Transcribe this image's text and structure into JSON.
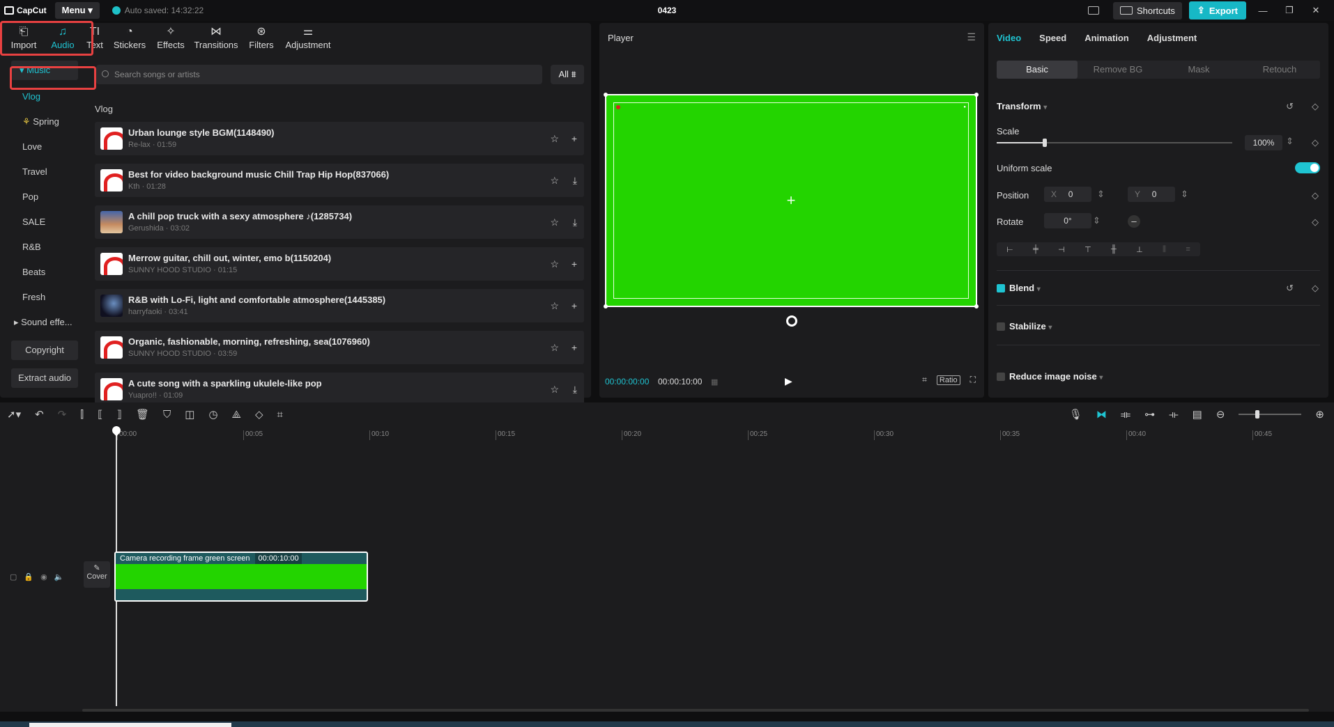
{
  "titlebar": {
    "brand": "CapCut",
    "menu": "Menu",
    "autosave": "Auto saved: 14:32:22",
    "project_title": "0423",
    "shortcuts": "Shortcuts",
    "export": "Export"
  },
  "tools": [
    {
      "label": "Import",
      "icon": "import-icon"
    },
    {
      "label": "Audio",
      "icon": "audio-icon"
    },
    {
      "label": "Text",
      "icon": "text-icon"
    },
    {
      "label": "Stickers",
      "icon": "stickers-icon"
    },
    {
      "label": "Effects",
      "icon": "effects-icon"
    },
    {
      "label": "Transitions",
      "icon": "transitions-icon"
    },
    {
      "label": "Filters",
      "icon": "filters-icon"
    },
    {
      "label": "Adjustment",
      "icon": "adjustment-icon"
    }
  ],
  "categories": {
    "music": "Music",
    "items": [
      "Vlog",
      "Spring",
      "Love",
      "Travel",
      "Pop",
      "SALE",
      "R&B",
      "Beats",
      "Fresh"
    ],
    "sound_effects": "Sound effe...",
    "copyright": "Copyright",
    "extract_audio": "Extract audio"
  },
  "search": {
    "placeholder": "Search songs or artists",
    "filter": "All"
  },
  "section_title": "Vlog",
  "songs": [
    {
      "title": "Urban lounge style BGM(1148490)",
      "meta": "Re-lax · 01:59",
      "thumb": "red"
    },
    {
      "title": "Best for video background music Chill Trap Hip Hop(837066)",
      "meta": "Kth · 01:28",
      "thumb": "red"
    },
    {
      "title": "A chill pop truck with a sexy atmosphere ♪(1285734)",
      "meta": "Gerushida · 03:02",
      "thumb": "sky"
    },
    {
      "title": "Merrow guitar, chill out, winter, emo b(1150204)",
      "meta": "SUNNY HOOD STUDIO · 01:15",
      "thumb": "red"
    },
    {
      "title": "R&B with Lo-Fi, light and comfortable atmosphere(1445385)",
      "meta": "harryfaoki · 03:41",
      "thumb": "dark"
    },
    {
      "title": "Organic, fashionable, morning, refreshing, sea(1076960)",
      "meta": "SUNNY HOOD STUDIO · 03:59",
      "thumb": "red"
    },
    {
      "title": "A cute song with a sparkling ukulele-like pop",
      "meta": "Yuapro!! · 01:09",
      "thumb": "red"
    }
  ],
  "player": {
    "title": "Player",
    "current_time": "00:00:00:00",
    "total_time": "00:00:10:00",
    "ratio": "Ratio"
  },
  "inspector": {
    "tabs": [
      "Video",
      "Speed",
      "Animation",
      "Adjustment"
    ],
    "subtabs": [
      "Basic",
      "Remove BG",
      "Mask",
      "Retouch"
    ],
    "transform": "Transform",
    "scale_label": "Scale",
    "scale_value": "100%",
    "scale_fraction": 0.2,
    "uniform_scale": "Uniform scale",
    "position_label": "Position",
    "x_label": "X",
    "x_value": "0",
    "y_label": "Y",
    "y_value": "0",
    "rotate_label": "Rotate",
    "rotate_value": "0°",
    "blend": "Blend",
    "stabilize": "Stabilize",
    "reduce_noise": "Reduce image noise"
  },
  "timeline": {
    "ticks": [
      "00:00",
      "00:05",
      "00:10",
      "00:15",
      "00:20",
      "00:25",
      "00:30",
      "00:35",
      "00:40",
      "00:45"
    ],
    "cover": "Cover",
    "clip_name": "Camera recording frame green screen",
    "clip_duration": "00:00:10:00"
  },
  "colors": {
    "accent": "#1fc4d2",
    "green_screen": "#23d400",
    "highlight": "#e84141"
  }
}
